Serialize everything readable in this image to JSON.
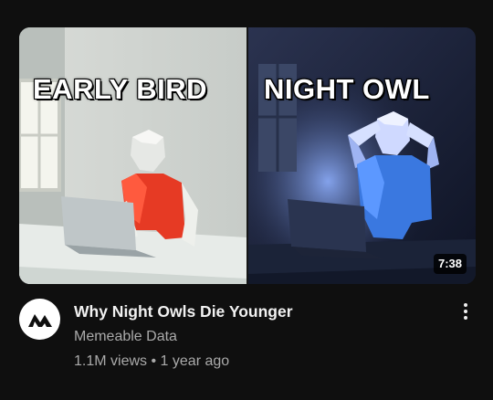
{
  "video": {
    "title": "Why Night Owls Die Younger",
    "channel": "Memeable Data",
    "views": "1.1M views",
    "separator": "•",
    "age": "1 year ago",
    "duration": "7:38"
  },
  "thumbnail": {
    "left_caption": "EARLY BIRD",
    "right_caption": "NIGHT OWL"
  },
  "icons": {
    "avatar": "memeable-data-logo-icon",
    "menu": "more-vert-icon"
  },
  "colors": {
    "background": "#0f0f0f",
    "title": "#f1f1f1",
    "secondary_text": "#aaaaaa",
    "shirt_left": "#e63a24",
    "shirt_right": "#3a78e0"
  }
}
